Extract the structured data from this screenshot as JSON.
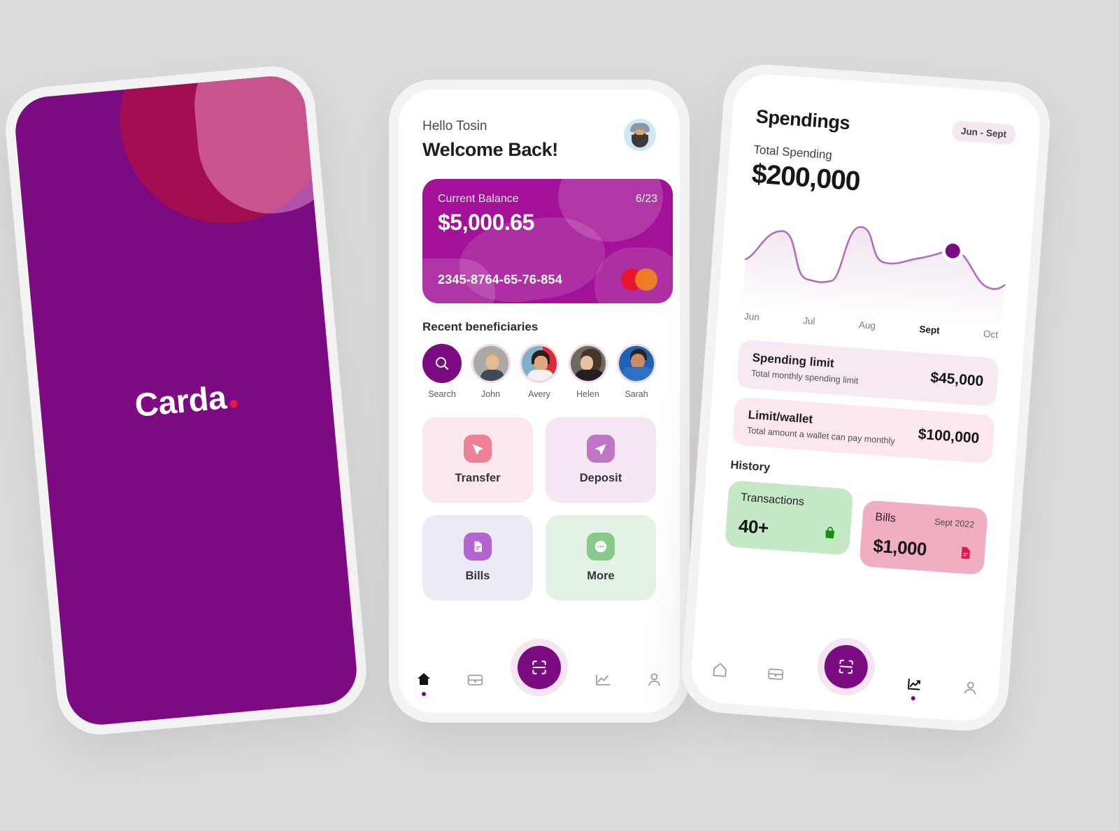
{
  "theme": {
    "brand_purple": "#7c0a80",
    "card_magenta": "#a21197",
    "accent_red": "#e31b3d",
    "page_background": "#dcdcdc"
  },
  "splash_screen": {
    "logo_text": "Carda",
    "logo_dot": "brand-dot"
  },
  "home_screen": {
    "greeting_small": "Hello Tosin",
    "greeting_large": "Welcome Back!",
    "avatar": "user-avatar",
    "card": {
      "label": "Current Balance",
      "expiry": "6/23",
      "balance": "$5,000.65",
      "number": "2345-8764-65-76-854",
      "network_logo": "mastercard-logo"
    },
    "beneficiaries_title": "Recent beneficiaries",
    "beneficiaries": [
      {
        "name": "Search",
        "type": "search-icon"
      },
      {
        "name": "John",
        "type": "avatar"
      },
      {
        "name": "Avery",
        "type": "avatar"
      },
      {
        "name": "Helen",
        "type": "avatar"
      },
      {
        "name": "Sarah",
        "type": "avatar"
      }
    ],
    "actions": [
      {
        "label": "Transfer",
        "icon": "send-icon",
        "tile_bg": "#fbe7ee",
        "icon_bg": "#ee8198"
      },
      {
        "label": "Deposit",
        "icon": "receive-icon",
        "tile_bg": "#f5e7f3",
        "icon_bg": "#c176c5"
      },
      {
        "label": "Bills",
        "icon": "document-icon",
        "tile_bg": "#eceaf5",
        "icon_bg": "#b464d1"
      },
      {
        "label": "More",
        "icon": "ellipsis-icon",
        "tile_bg": "#e3f2e4",
        "icon_bg": "#86c98b"
      }
    ],
    "nav": [
      {
        "name": "home",
        "icon": "home-icon",
        "active": true
      },
      {
        "name": "wallet",
        "icon": "wallet-icon",
        "active": false
      },
      {
        "name": "scan",
        "icon": "scan-icon",
        "active": false
      },
      {
        "name": "stats",
        "icon": "chart-icon",
        "active": false
      },
      {
        "name": "profile",
        "icon": "person-icon",
        "active": false
      }
    ]
  },
  "spendings_screen": {
    "title": "Spendings",
    "range_pill": "Jun - Sept",
    "total_label": "Total Spending",
    "total_value": "$200,000",
    "limits": [
      {
        "title": "Spending limit",
        "subtitle": "Total monthly spending limit",
        "amount": "$45,000",
        "bg": "#f6e9f4"
      },
      {
        "title": "Limit/wallet",
        "subtitle": "Total amount a wallet can pay monthly",
        "amount": "$100,000",
        "bg": "#fbe7ed"
      }
    ],
    "history_title": "History",
    "history": [
      {
        "label": "Transactions",
        "value": "40+",
        "date": "",
        "icon": "shopping-bag-icon",
        "bg": "#c5e8c5",
        "icon_color": "#119211"
      },
      {
        "label": "Bills",
        "value": "$1,000",
        "date": "Sept 2022",
        "icon": "document-icon",
        "bg": "#f0aec0",
        "icon_color": "#d81b4e"
      }
    ],
    "nav": [
      {
        "name": "home",
        "icon": "home-icon",
        "active": false
      },
      {
        "name": "wallet",
        "icon": "wallet-icon",
        "active": false
      },
      {
        "name": "scan",
        "icon": "scan-icon",
        "active": false
      },
      {
        "name": "stats",
        "icon": "chart-trend-icon",
        "active": true
      },
      {
        "name": "profile",
        "icon": "person-icon",
        "active": false
      }
    ]
  },
  "chart_data": {
    "type": "line",
    "title": "Total Spending",
    "xlabel": "",
    "ylabel": "",
    "categories": [
      "Jun",
      "Jul",
      "Aug",
      "Sept",
      "Oct"
    ],
    "tick_labels": [
      "Jun",
      "Jul",
      "Aug",
      "Sept",
      "Oct"
    ],
    "active_category": "Sept",
    "x": [
      0,
      0.5,
      1,
      1.5,
      2,
      2.5,
      3,
      3.5,
      4
    ],
    "values": [
      52,
      74,
      30,
      28,
      82,
      60,
      62,
      68,
      40
    ],
    "ylim": [
      0,
      100
    ],
    "grid": false,
    "legend": false,
    "line_color": "#b36fb8",
    "marker": {
      "category": "Sept",
      "value": 68,
      "color": "#7c0a80"
    },
    "area_fill": "rgba(150,60,150,0.07)"
  }
}
